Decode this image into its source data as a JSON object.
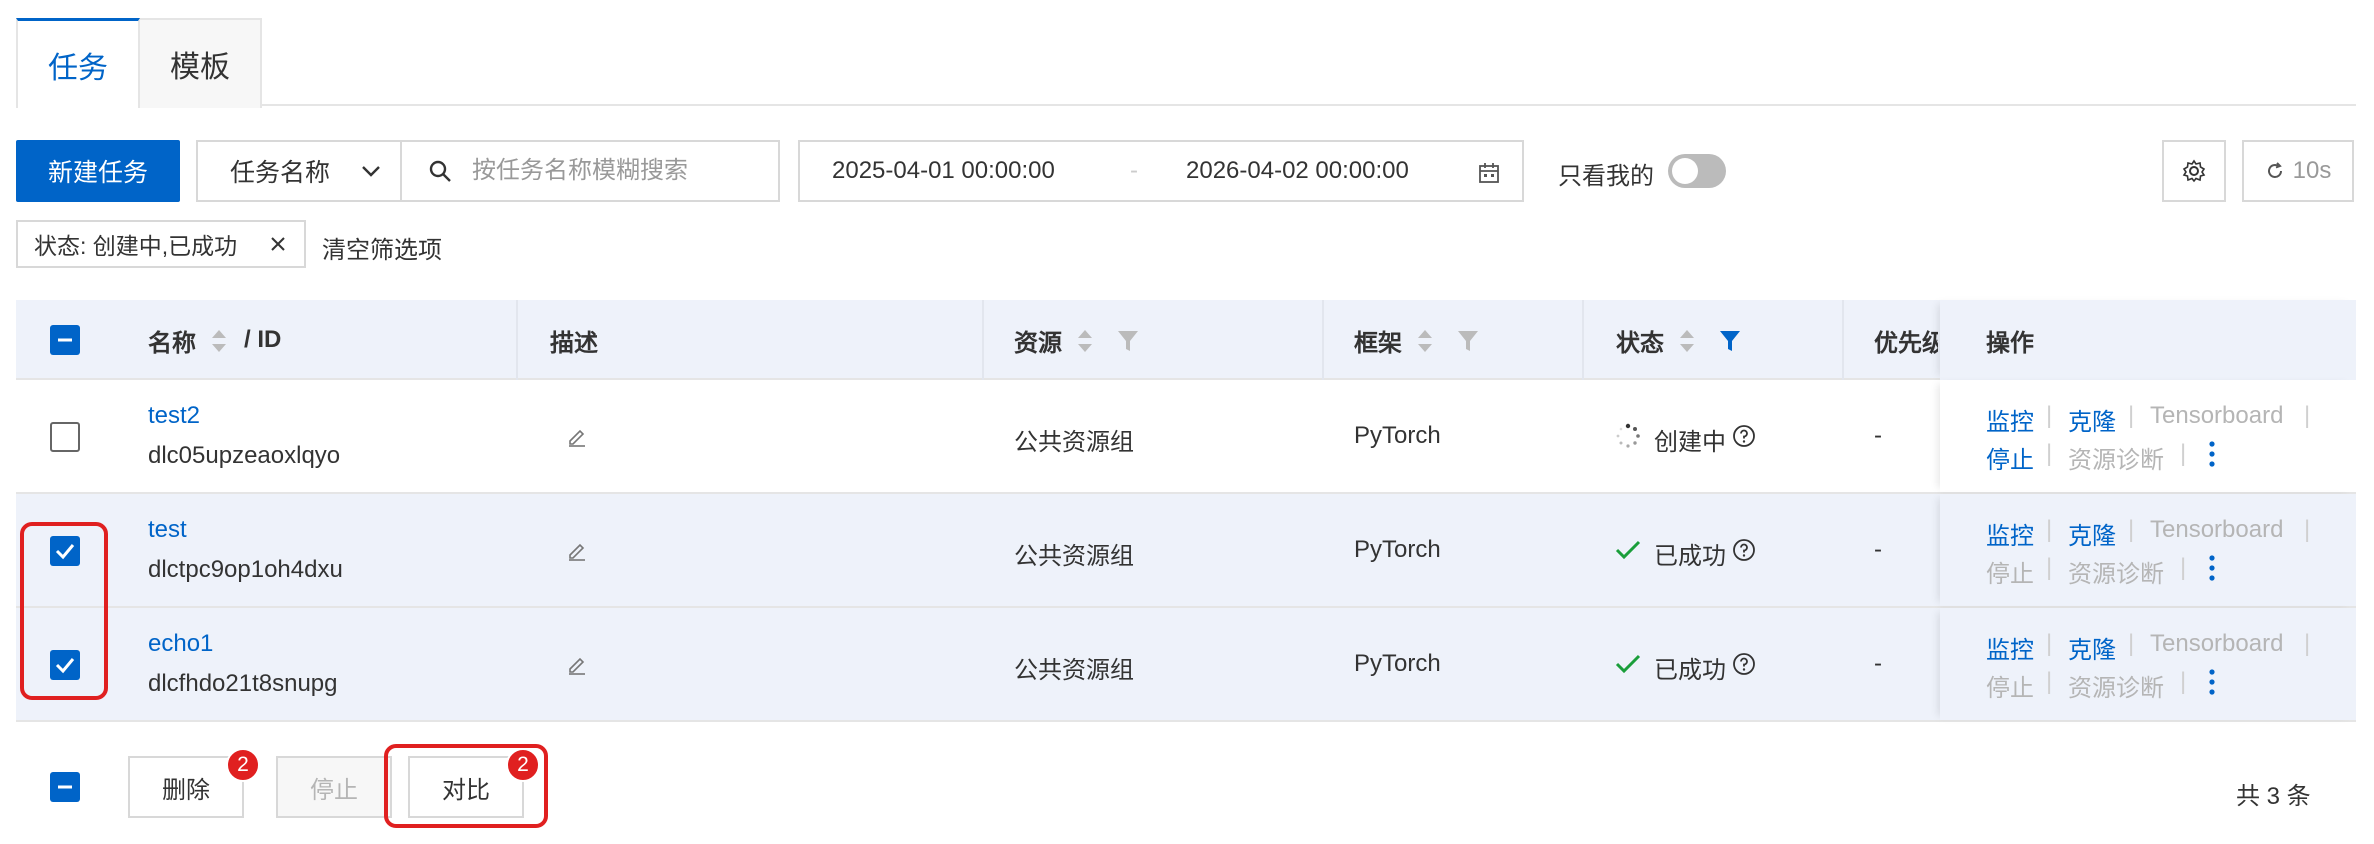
{
  "tabs": [
    {
      "label": "任务"
    },
    {
      "label": "模板"
    }
  ],
  "toolbar": {
    "new_task": "新建任务",
    "field_select": "任务名称",
    "search_placeholder": "按任务名称模糊搜索",
    "date_start": "2025-04-01 00:00:00",
    "date_sep": "-",
    "date_end": "2026-04-02 00:00:00",
    "only_mine": "只看我的",
    "refresh_interval": "10s"
  },
  "filters": {
    "tag": "状态: 创建中,已成功",
    "clear": "清空筛选项"
  },
  "table": {
    "columns": {
      "name": "名称",
      "id": "/ ID",
      "desc": "描述",
      "resource": "资源",
      "framework": "框架",
      "status": "状态",
      "priority": "优先级",
      "ops": "操作"
    },
    "rows": [
      {
        "name": "test2",
        "id": "dlc05upzeaoxlqyo",
        "resource": "公共资源组",
        "framework": "PyTorch",
        "status": "创建中",
        "priority": "-",
        "selected": false
      },
      {
        "name": "test",
        "id": "dlctpc9op1oh4dxu",
        "resource": "公共资源组",
        "framework": "PyTorch",
        "status": "已成功",
        "priority": "-",
        "selected": true
      },
      {
        "name": "echo1",
        "id": "dlcfhdo21t8snupg",
        "resource": "公共资源组",
        "framework": "PyTorch",
        "status": "已成功",
        "priority": "-",
        "selected": true
      }
    ],
    "ops": {
      "monitor": "监控",
      "clone": "克隆",
      "tensorboard": "Tensorboard",
      "stop": "停止",
      "diagnose": "资源诊断"
    }
  },
  "bulk": {
    "delete": "删除",
    "delete_count": "2",
    "stop": "停止",
    "compare": "对比",
    "compare_count": "2",
    "total": "共 3 条"
  },
  "colors": {
    "primary": "#0064c8",
    "success": "#1a9e3a",
    "danger": "#e02020"
  }
}
